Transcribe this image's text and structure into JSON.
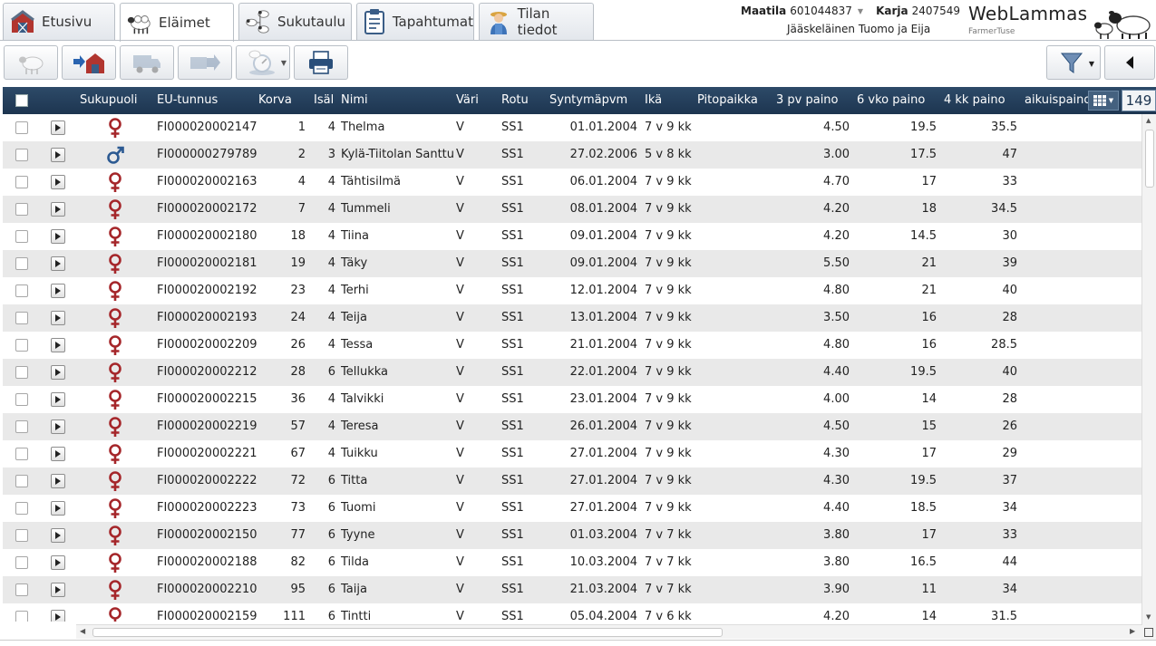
{
  "tabs": [
    {
      "label": "Etusivu",
      "icon": "barn-icon"
    },
    {
      "label": "Eläimet",
      "icon": "sheep-icon"
    },
    {
      "label": "Sukutaulu",
      "icon": "family-tree-icon"
    },
    {
      "label": "Tapahtumat",
      "icon": "clipboard-icon"
    },
    {
      "label": "Tilan tiedot",
      "icon": "farmer-icon"
    }
  ],
  "farm": {
    "maatila_label": "Maatila",
    "maatila_value": "601044837",
    "karja_label": "Karja",
    "karja_value": "2407549",
    "owner": "Jääskeläinen Tuomo ja Eija"
  },
  "brand": {
    "name": "WebLammas",
    "sub": "FarmerTuse"
  },
  "grid": {
    "columns": {
      "sukupuoli": "Sukupuoli",
      "eu": "EU-tunnus",
      "korva": "Korva",
      "isal": "Isäl",
      "nimi": "Nimi",
      "vari": "Väri",
      "rotu": "Rotu",
      "syntymapvm": "Syntymäpvm",
      "ika": "Ikä",
      "pitopaikka": "Pitopaikka",
      "pv3": "3 pv paino",
      "vko6": "6 vko paino",
      "kk4": "4 kk paino",
      "aikuis": "aikuispaino"
    },
    "count": "149",
    "rows": [
      {
        "sex": "female",
        "eu": "FI000020002147",
        "korva": "1",
        "isal": "4",
        "nimi": "Thelma",
        "vari": "V",
        "rotu": "SS1",
        "pvm": "01.01.2004",
        "ika": "7 v 9 kk",
        "pito": "",
        "pv3": "4.50",
        "vko6": "19.5",
        "kk4": "35.5"
      },
      {
        "sex": "male",
        "eu": "FI000000279789",
        "korva": "2",
        "isal": "3",
        "nimi": "Kylä-Tiitolan Santtu",
        "vari": "V",
        "rotu": "SS1",
        "pvm": "27.02.2006",
        "ika": "5 v 8 kk",
        "pito": "",
        "pv3": "3.00",
        "vko6": "17.5",
        "kk4": "47"
      },
      {
        "sex": "female",
        "eu": "FI000020002163",
        "korva": "4",
        "isal": "4",
        "nimi": "Tähtisilmä",
        "vari": "V",
        "rotu": "SS1",
        "pvm": "06.01.2004",
        "ika": "7 v 9 kk",
        "pito": "",
        "pv3": "4.70",
        "vko6": "17",
        "kk4": "33"
      },
      {
        "sex": "female",
        "eu": "FI000020002172",
        "korva": "7",
        "isal": "4",
        "nimi": "Tummeli",
        "vari": "V",
        "rotu": "SS1",
        "pvm": "08.01.2004",
        "ika": "7 v 9 kk",
        "pito": "",
        "pv3": "4.20",
        "vko6": "18",
        "kk4": "34.5"
      },
      {
        "sex": "female",
        "eu": "FI000020002180",
        "korva": "18",
        "isal": "4",
        "nimi": "Tiina",
        "vari": "V",
        "rotu": "SS1",
        "pvm": "09.01.2004",
        "ika": "7 v 9 kk",
        "pito": "",
        "pv3": "4.20",
        "vko6": "14.5",
        "kk4": "30"
      },
      {
        "sex": "female",
        "eu": "FI000020002181",
        "korva": "19",
        "isal": "4",
        "nimi": "Täky",
        "vari": "V",
        "rotu": "SS1",
        "pvm": "09.01.2004",
        "ika": "7 v 9 kk",
        "pito": "",
        "pv3": "5.50",
        "vko6": "21",
        "kk4": "39"
      },
      {
        "sex": "female",
        "eu": "FI000020002192",
        "korva": "23",
        "isal": "4",
        "nimi": "Terhi",
        "vari": "V",
        "rotu": "SS1",
        "pvm": "12.01.2004",
        "ika": "7 v 9 kk",
        "pito": "",
        "pv3": "4.80",
        "vko6": "21",
        "kk4": "40"
      },
      {
        "sex": "female",
        "eu": "FI000020002193",
        "korva": "24",
        "isal": "4",
        "nimi": "Teija",
        "vari": "V",
        "rotu": "SS1",
        "pvm": "13.01.2004",
        "ika": "7 v 9 kk",
        "pito": "",
        "pv3": "3.50",
        "vko6": "16",
        "kk4": "28"
      },
      {
        "sex": "female",
        "eu": "FI000020002209",
        "korva": "26",
        "isal": "4",
        "nimi": "Tessa",
        "vari": "V",
        "rotu": "SS1",
        "pvm": "21.01.2004",
        "ika": "7 v 9 kk",
        "pito": "",
        "pv3": "4.80",
        "vko6": "16",
        "kk4": "28.5"
      },
      {
        "sex": "female",
        "eu": "FI000020002212",
        "korva": "28",
        "isal": "6",
        "nimi": "Tellukka",
        "vari": "V",
        "rotu": "SS1",
        "pvm": "22.01.2004",
        "ika": "7 v 9 kk",
        "pito": "",
        "pv3": "4.40",
        "vko6": "19.5",
        "kk4": "40"
      },
      {
        "sex": "female",
        "eu": "FI000020002215",
        "korva": "36",
        "isal": "4",
        "nimi": "Talvikki",
        "vari": "V",
        "rotu": "SS1",
        "pvm": "23.01.2004",
        "ika": "7 v 9 kk",
        "pito": "",
        "pv3": "4.00",
        "vko6": "14",
        "kk4": "28"
      },
      {
        "sex": "female",
        "eu": "FI000020002219",
        "korva": "57",
        "isal": "4",
        "nimi": "Teresa",
        "vari": "V",
        "rotu": "SS1",
        "pvm": "26.01.2004",
        "ika": "7 v 9 kk",
        "pito": "",
        "pv3": "4.50",
        "vko6": "15",
        "kk4": "26"
      },
      {
        "sex": "female",
        "eu": "FI000020002221",
        "korva": "67",
        "isal": "4",
        "nimi": "Tuikku",
        "vari": "V",
        "rotu": "SS1",
        "pvm": "27.01.2004",
        "ika": "7 v 9 kk",
        "pito": "",
        "pv3": "4.30",
        "vko6": "17",
        "kk4": "29"
      },
      {
        "sex": "female",
        "eu": "FI000020002222",
        "korva": "72",
        "isal": "6",
        "nimi": "Titta",
        "vari": "V",
        "rotu": "SS1",
        "pvm": "27.01.2004",
        "ika": "7 v 9 kk",
        "pito": "",
        "pv3": "4.30",
        "vko6": "19.5",
        "kk4": "37"
      },
      {
        "sex": "female",
        "eu": "FI000020002223",
        "korva": "73",
        "isal": "6",
        "nimi": "Tuomi",
        "vari": "V",
        "rotu": "SS1",
        "pvm": "27.01.2004",
        "ika": "7 v 9 kk",
        "pito": "",
        "pv3": "4.40",
        "vko6": "18.5",
        "kk4": "34"
      },
      {
        "sex": "female",
        "eu": "FI000020002150",
        "korva": "77",
        "isal": "6",
        "nimi": "Tyyne",
        "vari": "V",
        "rotu": "SS1",
        "pvm": "01.03.2004",
        "ika": "7 v 7 kk",
        "pito": "",
        "pv3": "3.80",
        "vko6": "17",
        "kk4": "33"
      },
      {
        "sex": "female",
        "eu": "FI000020002188",
        "korva": "82",
        "isal": "6",
        "nimi": "Tilda",
        "vari": "V",
        "rotu": "SS1",
        "pvm": "10.03.2004",
        "ika": "7 v 7 kk",
        "pito": "",
        "pv3": "3.80",
        "vko6": "16.5",
        "kk4": "44"
      },
      {
        "sex": "female",
        "eu": "FI000020002210",
        "korva": "95",
        "isal": "6",
        "nimi": "Taija",
        "vari": "V",
        "rotu": "SS1",
        "pvm": "21.03.2004",
        "ika": "7 v 7 kk",
        "pito": "",
        "pv3": "3.90",
        "vko6": "11",
        "kk4": "34"
      },
      {
        "sex": "female",
        "eu": "FI000020002159",
        "korva": "111",
        "isal": "6",
        "nimi": "Tintti",
        "vari": "V",
        "rotu": "SS1",
        "pvm": "05.04.2004",
        "ika": "7 v 6 kk",
        "pito": "",
        "pv3": "4.20",
        "vko6": "14",
        "kk4": "31.5"
      }
    ]
  },
  "colors": {
    "header": "#1d3550",
    "female": "#a5262a",
    "male": "#2c5a92",
    "alt_row": "#e9e9e9"
  }
}
